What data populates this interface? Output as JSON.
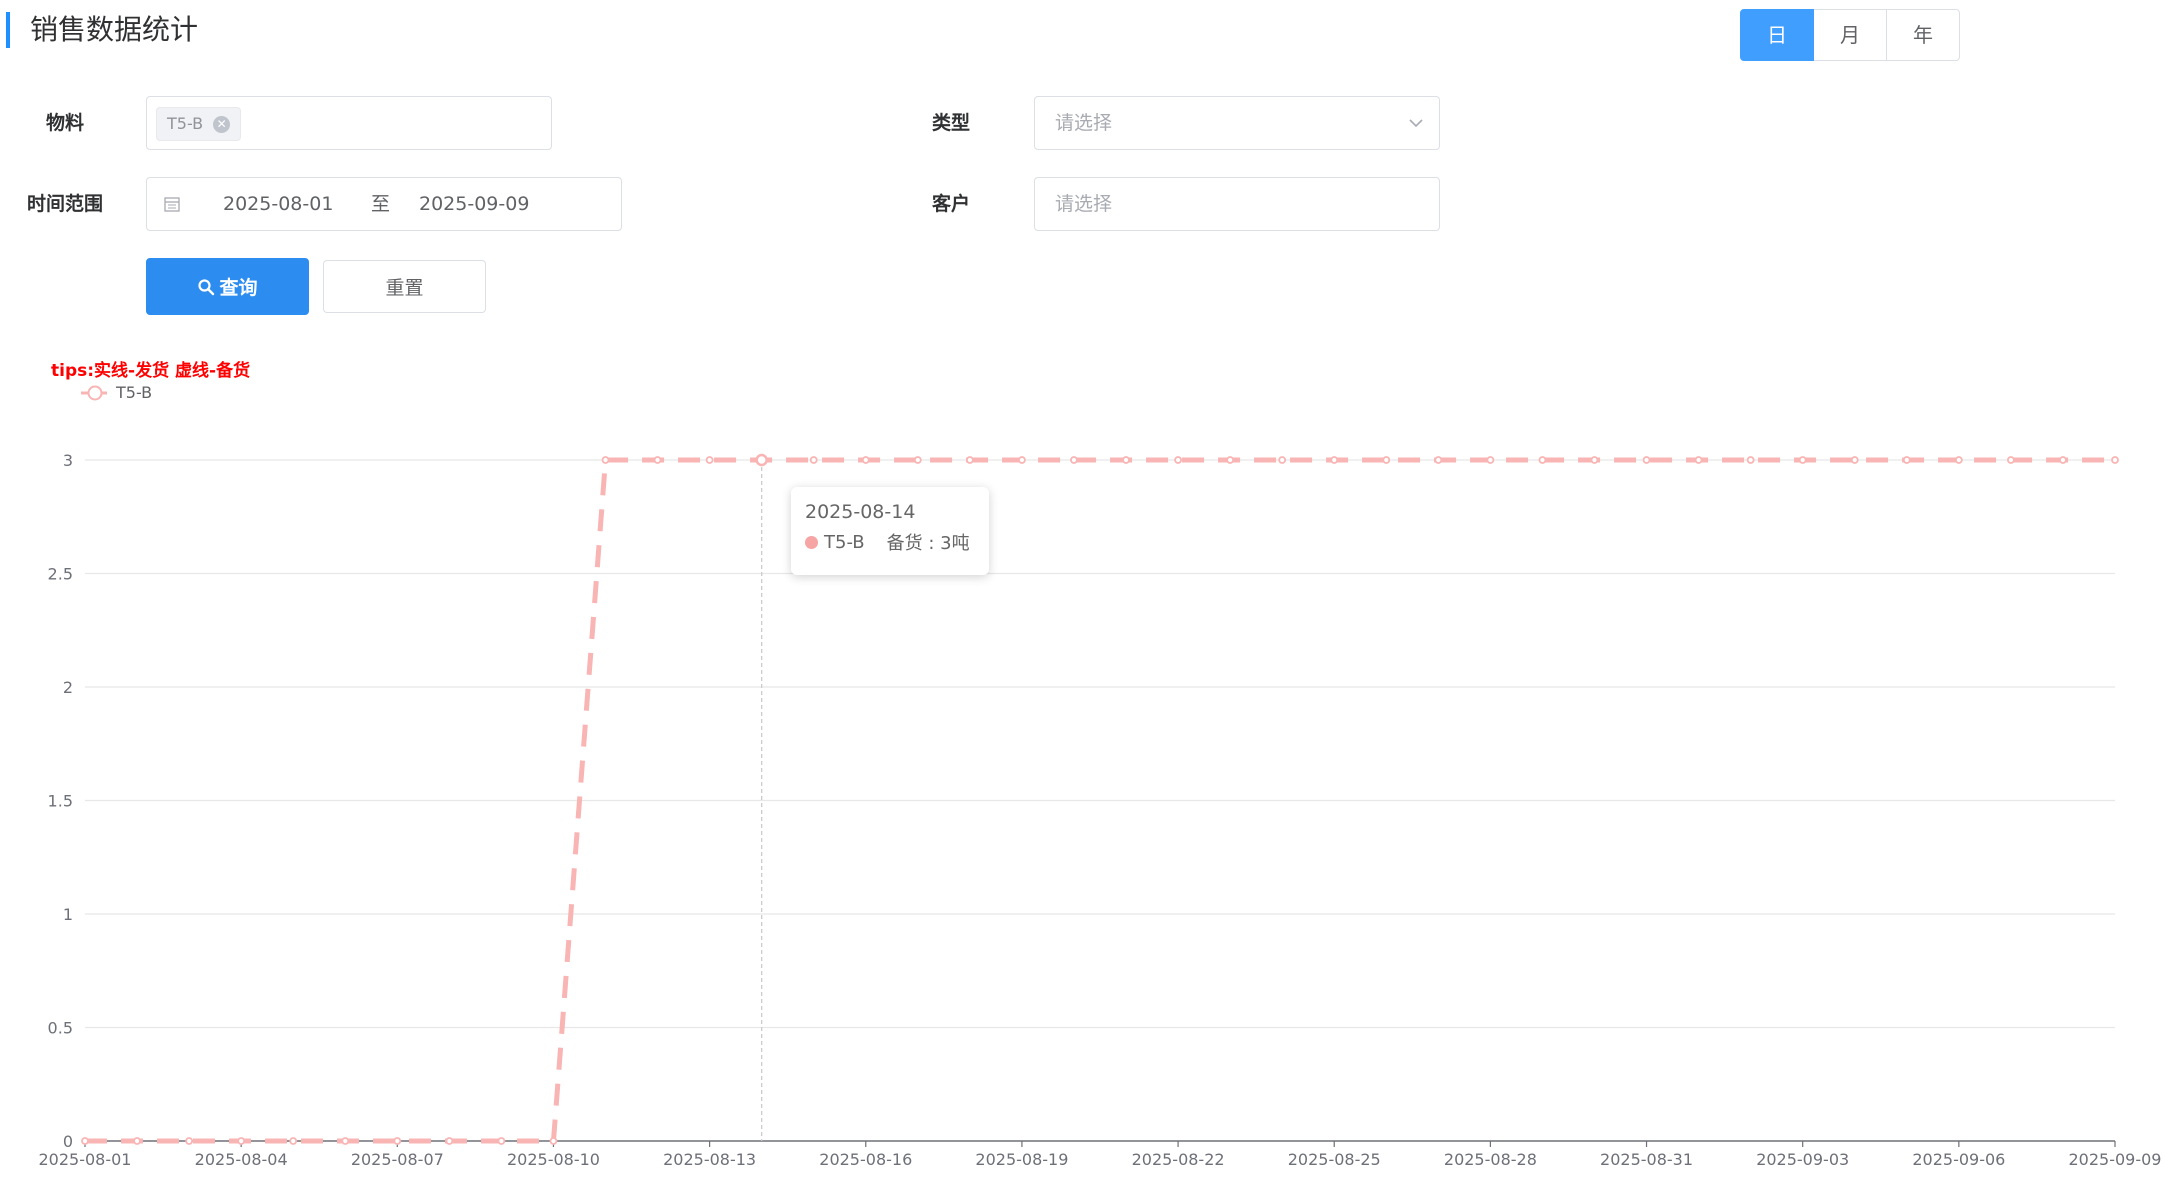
{
  "header": {
    "title": "销售数据统计",
    "period_tabs": [
      {
        "label": "日",
        "active": true
      },
      {
        "label": "月",
        "active": false
      },
      {
        "label": "年",
        "active": false
      }
    ]
  },
  "form": {
    "material_label": "物料",
    "material_tag": "T5-B",
    "type_label": "类型",
    "type_placeholder": "请选择",
    "time_range_label": "时间范围",
    "start_date": "2025-08-01",
    "date_separator": "至",
    "end_date": "2025-09-09",
    "customer_label": "客户",
    "customer_placeholder": "请选择",
    "query_button": "查询",
    "reset_button": "重置"
  },
  "chart_tips": "tips:实线-发货 虚线-备货",
  "tooltip": {
    "date": "2025-08-14",
    "series": "T5-B",
    "label": "备货 : 3吨"
  },
  "colors": {
    "accent": "#409eff",
    "series": "#f9b4b4",
    "tips": "#ff0000"
  },
  "chart_data": {
    "type": "line",
    "title": "",
    "xlabel": "",
    "ylabel": "",
    "ylim": [
      0,
      3
    ],
    "y_ticks": [
      "0",
      "0.5",
      "1",
      "1.5",
      "2",
      "2.5",
      "3"
    ],
    "x_tick_labels": [
      "2025-08-01",
      "2025-08-04",
      "2025-08-07",
      "2025-08-10",
      "2025-08-13",
      "2025-08-16",
      "2025-08-19",
      "2025-08-22",
      "2025-08-25",
      "2025-08-28",
      "2025-08-31",
      "2025-09-03",
      "2025-09-06",
      "2025-09-09"
    ],
    "legend_position": "top-left",
    "series": [
      {
        "name": "T5-B",
        "line_style": "dashed",
        "x": [
          "2025-08-01",
          "2025-08-02",
          "2025-08-03",
          "2025-08-04",
          "2025-08-05",
          "2025-08-06",
          "2025-08-07",
          "2025-08-08",
          "2025-08-09",
          "2025-08-10",
          "2025-08-11",
          "2025-08-12",
          "2025-08-13",
          "2025-08-14",
          "2025-08-15",
          "2025-08-16",
          "2025-08-17",
          "2025-08-18",
          "2025-08-19",
          "2025-08-20",
          "2025-08-21",
          "2025-08-22",
          "2025-08-23",
          "2025-08-24",
          "2025-08-25",
          "2025-08-26",
          "2025-08-27",
          "2025-08-28",
          "2025-08-29",
          "2025-08-30",
          "2025-08-31",
          "2025-09-01",
          "2025-09-02",
          "2025-09-03",
          "2025-09-04",
          "2025-09-05",
          "2025-09-06",
          "2025-09-07",
          "2025-09-08",
          "2025-09-09"
        ],
        "values": [
          0,
          0,
          0,
          0,
          0,
          0,
          0,
          0,
          0,
          0,
          3,
          3,
          3,
          3,
          3,
          3,
          3,
          3,
          3,
          3,
          3,
          3,
          3,
          3,
          3,
          3,
          3,
          3,
          3,
          3,
          3,
          3,
          3,
          3,
          3,
          3,
          3,
          3,
          3,
          3
        ]
      }
    ],
    "highlighted_x": "2025-08-14"
  }
}
